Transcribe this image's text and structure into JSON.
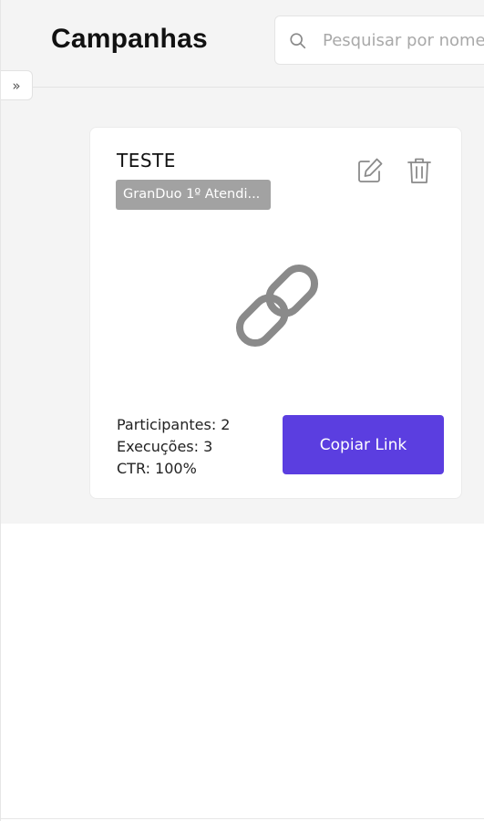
{
  "header": {
    "title": "Campanhas",
    "search": {
      "placeholder": "Pesquisar por nome",
      "value": ""
    }
  },
  "sidebar_toggle": {
    "icon": "chevrons-right-icon",
    "glyph": "»"
  },
  "campaign_card": {
    "title": "TESTE",
    "tag": "GranDuo 1º Atendi...",
    "edit_icon": "edit-icon",
    "delete_icon": "trash-icon",
    "illustration_icon": "link-icon",
    "stats": {
      "participants": "Participantes: 2",
      "executions": "Execuções: 3",
      "ctr": "CTR: 100%"
    },
    "copy_button_label": "Copiar Link"
  },
  "colors": {
    "accent": "#5b3ee0",
    "tag_bg": "#a2a2a2",
    "page_bg": "#f4f4f4",
    "icon_gray": "#8a8a8a"
  }
}
